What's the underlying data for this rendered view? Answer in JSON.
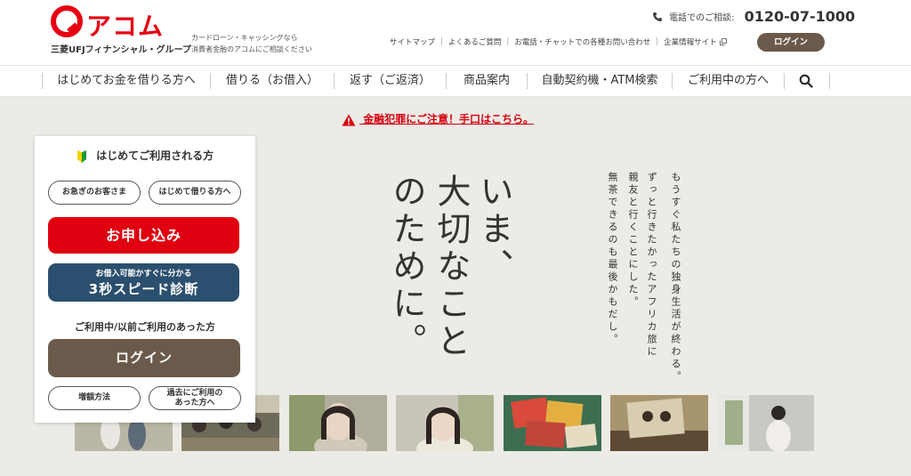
{
  "brand": {
    "logo_text": "アコム",
    "group_name": "三菱UFJフィナンシャル・グループ",
    "tagline_line1": "カードローン・キャッシングなら",
    "tagline_line2": "消費者金融のアコムにご相談ください",
    "color": "#e60012"
  },
  "header": {
    "phone_label": "電話でのご相談:",
    "phone_number": "0120-07-1000",
    "util_links": [
      "サイトマップ",
      "よくあるご質問",
      "お電話・チャットでの各種お問い合わせ",
      "企業情報サイト"
    ],
    "login_label": "ログイン"
  },
  "nav": {
    "items": [
      "はじめてお金を借りる方へ",
      "借りる（お借入）",
      "返す（ご返済）",
      "商品案内",
      "自動契約機・ATM検索",
      "ご利用中の方へ"
    ]
  },
  "hero": {
    "alert_text": "金融犯罪にご注意！手口はこちら。",
    "headline": [
      "いま、",
      "大切なこと",
      "のために。"
    ],
    "story": [
      "もうすぐ私たちの独身生活が終わる。",
      "ずっと行きたかったアフリカ旅に",
      "親友と行くことにした。",
      "無茶できるのも最後かもだし。"
    ]
  },
  "panel": {
    "title": "はじめてご利用される方",
    "btn_urgent": "お急ぎのお客さま",
    "btn_first": "はじめて借りる方へ",
    "btn_apply": "お申し込み",
    "speed_sub": "お借入可能かすぐに分かる",
    "speed_main": "3秒スピード診断",
    "returning_title": "ご利用中/以前ご利用のあった方",
    "btn_login": "ログイン",
    "btn_increase": "増額方法",
    "btn_past_l1": "過去にご利用の",
    "btn_past_l2": "あった方へ"
  },
  "colors": {
    "accent_red": "#e0000f",
    "speed_blue": "#2b4f6e",
    "login_brown": "#6b5a4b",
    "hero_bg": "#ecebe5"
  }
}
